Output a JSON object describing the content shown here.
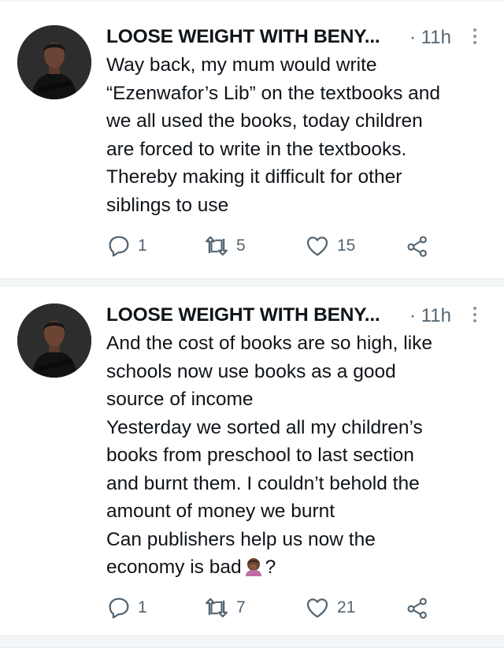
{
  "tweets": [
    {
      "author_name": "LOOSE WEIGHT WITH BENY...",
      "time": "· 11h",
      "lines": [
        "Way back, my mum would write",
        "“Ezenwafor’s Lib” on the textbooks and",
        "we all used the books, today children",
        "are forced to write in the textbooks.",
        "Thereby making it difficult for other",
        "siblings to use"
      ],
      "replies": "1",
      "retweets": "5",
      "likes": "15"
    },
    {
      "author_name": "LOOSE WEIGHT WITH BENY...",
      "time": "· 11h",
      "lines": [
        "And the cost of books are so high, like",
        "schools now use books as a good",
        "source of income",
        "Yesterday we sorted all my children’s",
        "books from preschool to last section",
        "and burnt them. I couldn’t behold the",
        "amount of money we burnt",
        "Can publishers help us now the"
      ],
      "last_line_start": "economy is bad",
      "last_line_end": "?",
      "emoji_icon": "woman-facepalming-emoji",
      "replies": "1",
      "retweets": "7",
      "likes": "21"
    }
  ],
  "colors": {
    "secondary_text": "#536471",
    "divider": "#f3f5f6",
    "icon": "#536471"
  }
}
